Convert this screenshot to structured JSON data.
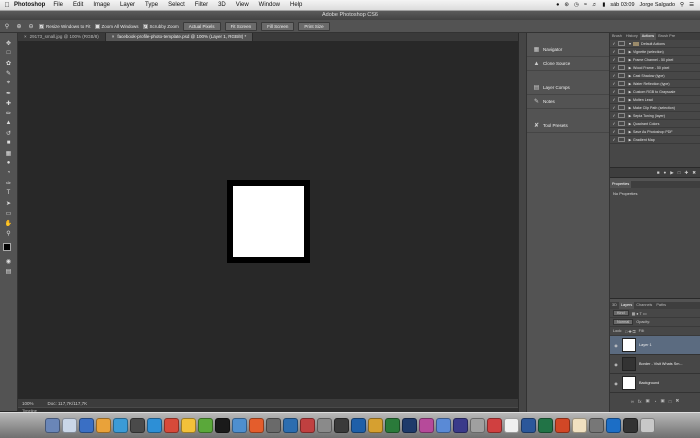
{
  "menubar": {
    "app": "Photoshop",
    "items": [
      "File",
      "Edit",
      "Image",
      "Layer",
      "Type",
      "Select",
      "Filter",
      "3D",
      "View",
      "Window",
      "Help"
    ],
    "clock": "sáb 03:09",
    "user": "Jorge Salgado"
  },
  "window_title": "Adobe Photoshop CS6",
  "options": {
    "resize_windows": "Resize Windows to Fit",
    "zoom_all": "Zoom All Windows",
    "scrubby": "Scrubby Zoom",
    "btn_actual": "Actual Pixels",
    "btn_fit": "Fit Screen",
    "btn_fill": "Fill Screen",
    "btn_print": "Print Size"
  },
  "tabs": [
    {
      "label": "29173_small.jpg @ 100% (RGB/8)"
    },
    {
      "label": "facebook-profile-photo-template.psd @ 100% (Layer 1, RGB/8) *"
    }
  ],
  "status": {
    "zoom": "100%",
    "doc": "Doc: 117,7K/117,7K"
  },
  "timeline": "Timeline",
  "collapsed_panels": {
    "navigator": "Navigator",
    "clone_source": "Clone Source",
    "layer_comps": "Layer Comps",
    "notes": "Notes",
    "tool_presets": "Tool Presets"
  },
  "actions_panel": {
    "tabs": [
      "Brush",
      "History",
      "Actions",
      "Brush Pre"
    ],
    "set_name": "Default Actions",
    "items": [
      "Vignette (selection)",
      "Frame Channel - 50 pixel",
      "Wood Frame - 50 pixel",
      "Cast Shadow (type)",
      "Water Reflection (type)",
      "Custom RGB to Grayscale",
      "Molten Lead",
      "Make Clip Path (selection)",
      "Sepia Toning (layer)",
      "Quadrant Colors",
      "Save As Photoshop PDF",
      "Gradient Map"
    ]
  },
  "properties": {
    "tab": "Properties",
    "body": "No Properties"
  },
  "layers_panel": {
    "tabs": [
      "3D",
      "Layers",
      "Channels",
      "Paths"
    ],
    "kind": "Kind",
    "blend": "Normal",
    "opacity": "Opacity:",
    "lock": "Lock:",
    "fill": "Fill:",
    "layers": [
      {
        "name": "Layer 1",
        "selected": true
      },
      {
        "name": "Border - Visit Whats Sm...",
        "selected": false
      },
      {
        "name": "Background",
        "selected": false
      }
    ]
  },
  "colors": {
    "dock_icons": [
      "#6a86b8",
      "#c9d6e8",
      "#3a6fc4",
      "#e9a23a",
      "#3b9bd6",
      "#4a4a4a",
      "#2d8fd6",
      "#d74a3a",
      "#f2c13a",
      "#5aa83a",
      "#1a1a1a",
      "#4e8fcf",
      "#e45d2c",
      "#6a6a6a",
      "#2b6db0",
      "#c04040",
      "#8a8a8a",
      "#3a3a3a",
      "#1e5fa8",
      "#d6a030",
      "#2a7a3a",
      "#1e3a6a",
      "#b64a9a",
      "#5a8ad6",
      "#3a3a8a",
      "#a0a0a0",
      "#d04040",
      "#f0f0f0",
      "#2b579a",
      "#217346",
      "#d24726",
      "#f0e0c0",
      "#777777",
      "#1c6ec6",
      "#333333",
      "#c8c8c8"
    ]
  }
}
